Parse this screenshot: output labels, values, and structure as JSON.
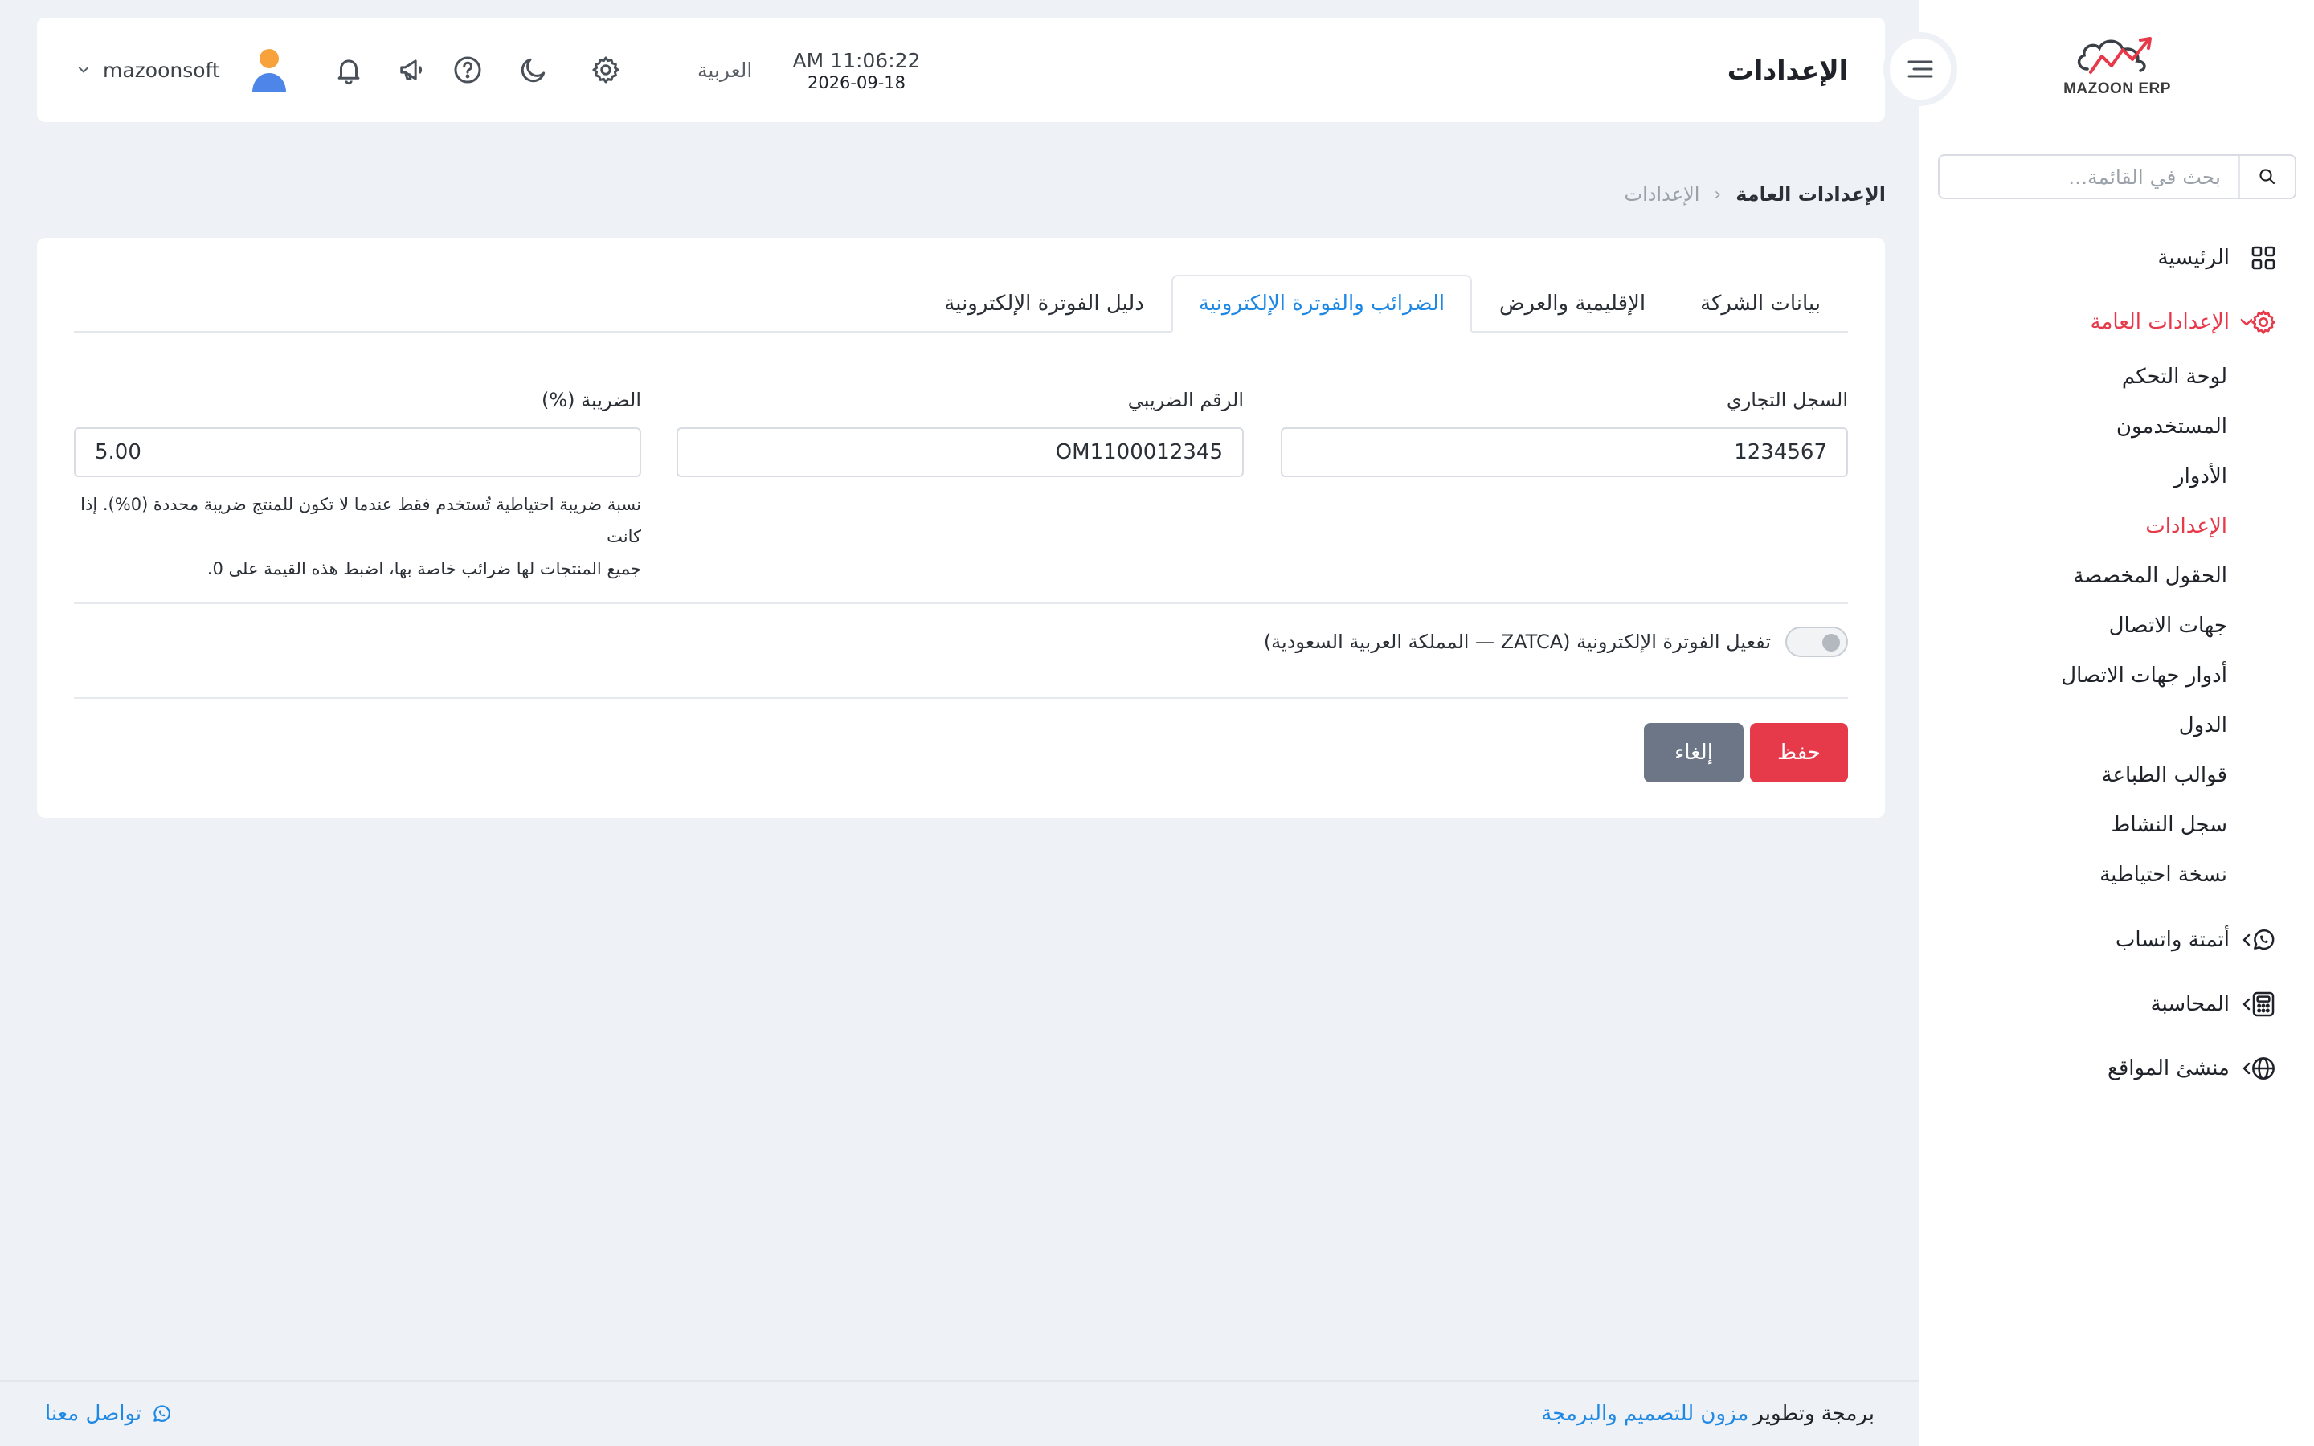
{
  "sidebar": {
    "logo_text": "MAZOON ERP",
    "search_placeholder": "بحث في القائمة...",
    "items": [
      {
        "label": "الرئيسية",
        "icon": "grid-icon"
      },
      {
        "label": "الإعدادات العامة",
        "icon": "gear-icon",
        "active": true
      }
    ],
    "sub_items": [
      "لوحة التحكم",
      "المستخدمون",
      "الأدوار",
      "الإعدادات",
      "الحقول المخصصة",
      "جهات الاتصال",
      "أدوار جهات الاتصال",
      "الدول",
      "قوالب الطباعة",
      "سجل النشاط",
      "نسخة احتياطية"
    ],
    "active_sub": "الإعدادات",
    "more_items": [
      {
        "label": "أتمتة واتساب",
        "icon": "whatsapp-icon"
      },
      {
        "label": "المحاسبة",
        "icon": "calculator-icon"
      },
      {
        "label": "منشئ المواقع",
        "icon": "globe-icon"
      }
    ]
  },
  "header": {
    "title": "الإعدادات",
    "time": "AM 11:06:22",
    "date": "2026-09-18",
    "language": "العربية",
    "username": "mazoonsoft"
  },
  "breadcrumb": {
    "current": "الإعدادات العامة",
    "separator": "‹",
    "parent": "الإعدادات"
  },
  "tabs": [
    {
      "label": "بيانات الشركة",
      "active": false
    },
    {
      "label": "الإقليمية والعرض",
      "active": false
    },
    {
      "label": "الضرائب والفوترة الإلكترونية",
      "active": true
    },
    {
      "label": "دليل الفوترة الإلكترونية",
      "active": false
    }
  ],
  "form": {
    "commercial_register": {
      "label": "السجل التجاري",
      "value": "1234567"
    },
    "tax_number": {
      "label": "الرقم الضريبي",
      "value": "OM1100012345"
    },
    "tax_rate": {
      "label": "الضريبة (%)",
      "value": "5.00",
      "help_line1": "نسبة ضريبة احتياطية تُستخدم فقط عندما لا تكون للمنتج ضريبة محددة (0%). إذا كانت",
      "help_line2": "جميع المنتجات لها ضرائب خاصة بها، اضبط هذه القيمة على 0."
    },
    "zatca_toggle_label": "تفعيل الفوترة الإلكترونية (ZATCA — المملكة العربية السعودية)",
    "zatca_enabled": false,
    "save_label": "حفظ",
    "cancel_label": "إلغاء"
  },
  "footer": {
    "credit_prefix": "برمجة وتطوير",
    "company": "مزون للتصميم والبرمجة",
    "contact": "تواصل معنا"
  },
  "colors": {
    "accent": "#e6394a",
    "link": "#1e88e5",
    "cancel": "#6c7687",
    "background": "#eef1f5"
  }
}
